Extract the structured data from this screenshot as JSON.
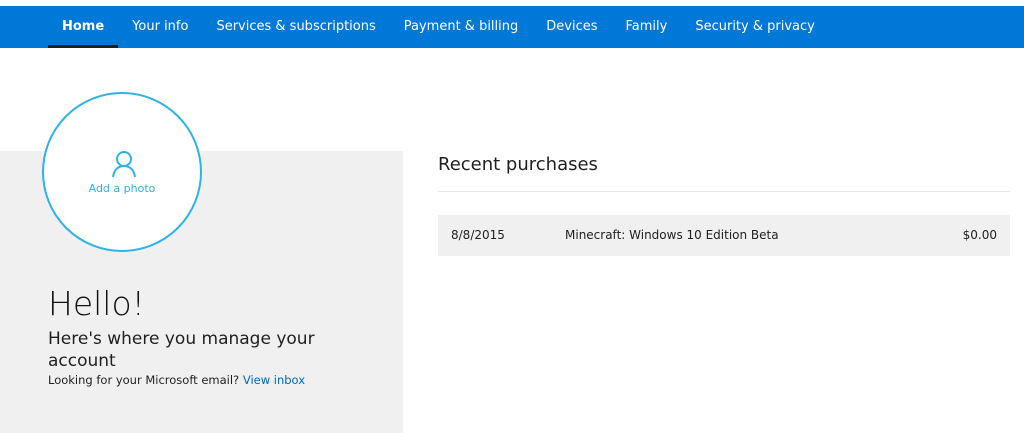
{
  "nav": {
    "items": [
      {
        "label": "Home",
        "active": true
      },
      {
        "label": "Your info",
        "active": false
      },
      {
        "label": "Services & subscriptions",
        "active": false
      },
      {
        "label": "Payment & billing",
        "active": false
      },
      {
        "label": "Devices",
        "active": false
      },
      {
        "label": "Family",
        "active": false
      },
      {
        "label": "Security & privacy",
        "active": false
      }
    ]
  },
  "profile": {
    "add_photo_label": "Add a photo",
    "avatar_icon": "person-icon"
  },
  "welcome": {
    "heading": "Hello!",
    "subheading": "Here's where you manage your account",
    "email_prompt": "Looking for your Microsoft email?",
    "email_link": "View inbox"
  },
  "recent_purchases": {
    "title": "Recent purchases",
    "rows": [
      {
        "date": "8/8/2015",
        "item": "Minecraft: Windows 10 Edition Beta",
        "price": "$0.00"
      }
    ]
  },
  "colors": {
    "nav_bg": "#0078d7",
    "avatar_accent": "#2fb2e6",
    "link": "#0067b8",
    "panel_bg": "#f0f0f0"
  }
}
